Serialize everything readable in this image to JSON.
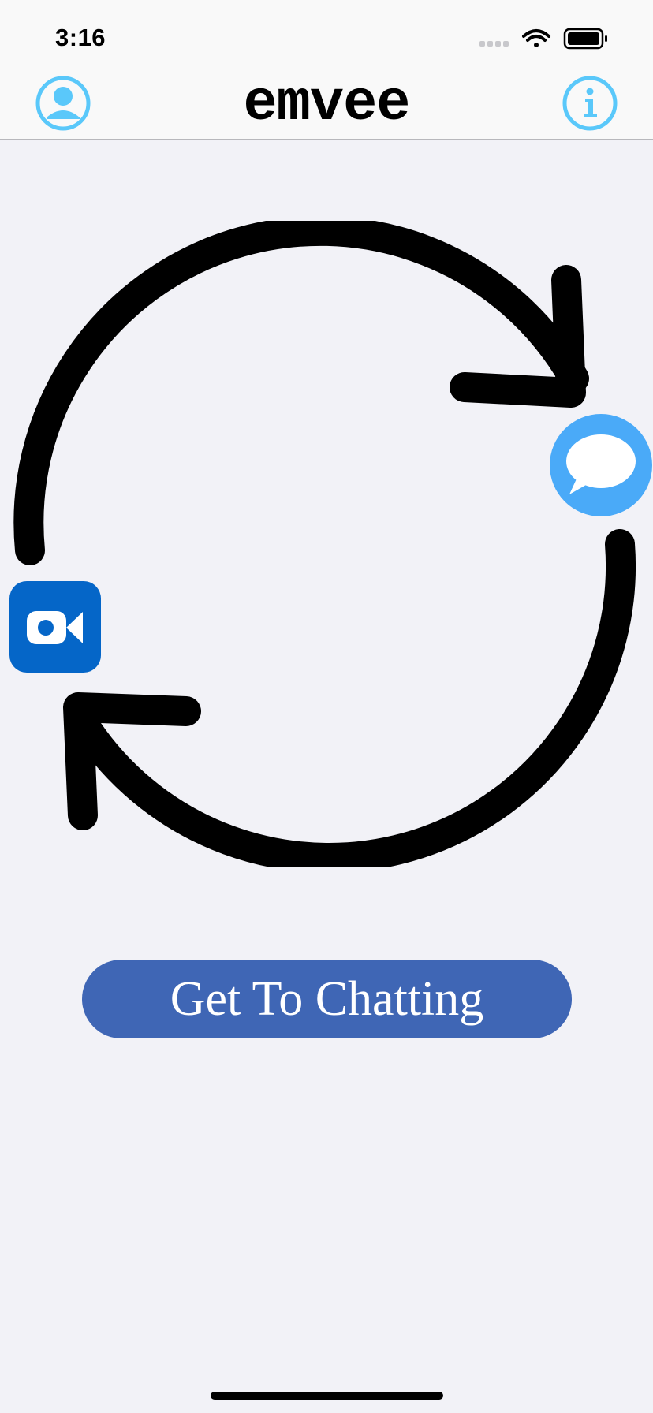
{
  "status_bar": {
    "time": "3:16"
  },
  "nav": {
    "title": "emvee",
    "left_icon": "profile-icon",
    "right_icon": "info-icon",
    "icon_color": "#5ac8fa"
  },
  "illustration": {
    "icons": [
      "message-bubble-icon",
      "video-camera-icon"
    ],
    "message_color": "#4aaaf8",
    "video_color": "#0566c8"
  },
  "main": {
    "cta_label": "Get To Chatting",
    "cta_color": "#3f66b5"
  }
}
